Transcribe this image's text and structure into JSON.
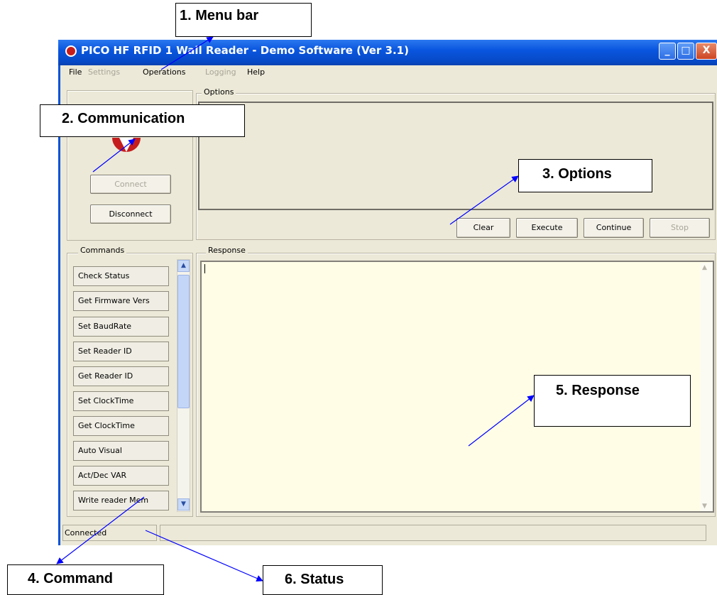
{
  "window": {
    "title": "PICO HF RFID 1 Wall Reader - Demo Software (Ver 3.1)",
    "controls": {
      "minimize": "_",
      "maximize": "□",
      "close": "X"
    }
  },
  "menu": {
    "items": [
      {
        "label": "File",
        "enabled": true
      },
      {
        "label": "Settings",
        "enabled": false
      },
      {
        "label": "Operations",
        "enabled": true
      },
      {
        "label": "Logging",
        "enabled": false
      },
      {
        "label": "Help",
        "enabled": true
      }
    ]
  },
  "communication": {
    "connect_label": "Connect",
    "disconnect_label": "Disconnect"
  },
  "options": {
    "group_label": "Options",
    "buttons": {
      "clear": "Clear",
      "execute": "Execute",
      "continue": "Continue",
      "stop": "Stop"
    }
  },
  "commands": {
    "group_label": "Commands",
    "items": [
      "Check Status",
      "Get  Firmware Vers",
      "Set BaudRate",
      "Set Reader ID",
      "Get Reader ID",
      "Set ClockTime",
      "Get ClockTime",
      "Auto Visual",
      "Act/Dec VAR",
      "Write reader Mem"
    ]
  },
  "response": {
    "group_label": "Response",
    "text": ""
  },
  "status": {
    "text": "Connected"
  },
  "callouts": {
    "menu_bar": "1. Menu bar",
    "communication": "2. Communication",
    "options": "3. Options",
    "command": "4. Command",
    "response": "5. Response",
    "status": "6. Status"
  },
  "colors": {
    "titlebar": "#0a56df",
    "window_bg": "#ece9d8",
    "response_bg": "#fffde6",
    "arrow": "#0000ff",
    "logo_red": "#c51d1d"
  }
}
